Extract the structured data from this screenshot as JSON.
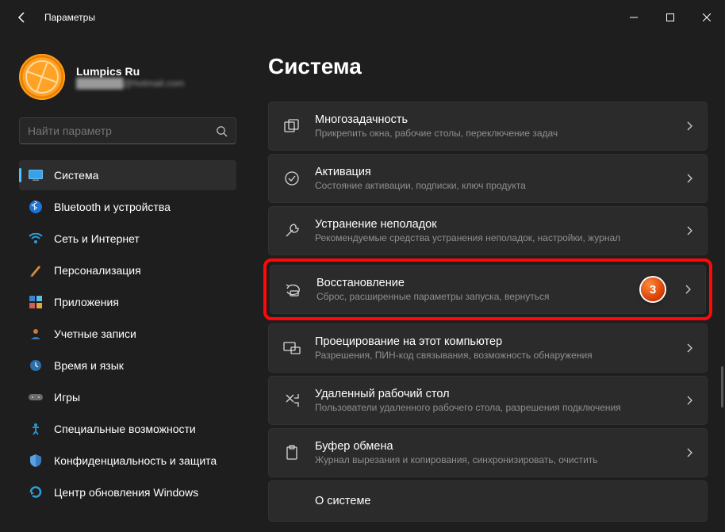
{
  "titlebar": {
    "title": "Параметры"
  },
  "user": {
    "name": "Lumpics Ru",
    "email": "███████@hotmail.com"
  },
  "search": {
    "placeholder": "Найти параметр"
  },
  "sidebar": {
    "items": [
      {
        "label": "Система"
      },
      {
        "label": "Bluetooth и устройства"
      },
      {
        "label": "Сеть и Интернет"
      },
      {
        "label": "Персонализация"
      },
      {
        "label": "Приложения"
      },
      {
        "label": "Учетные записи"
      },
      {
        "label": "Время и язык"
      },
      {
        "label": "Игры"
      },
      {
        "label": "Специальные возможности"
      },
      {
        "label": "Конфиденциальность и защита"
      },
      {
        "label": "Центр обновления Windows"
      }
    ]
  },
  "page": {
    "title": "Система"
  },
  "settings": [
    {
      "title": "Многозадачность",
      "desc": "Прикрепить окна, рабочие столы, переключение задач"
    },
    {
      "title": "Активация",
      "desc": "Состояние активации, подписки, ключ продукта"
    },
    {
      "title": "Устранение неполадок",
      "desc": "Рекомендуемые средства устранения неполадок, настройки, журнал"
    },
    {
      "title": "Восстановление",
      "desc": "Сброс, расширенные параметры запуска, вернуться"
    },
    {
      "title": "Проецирование на этот компьютер",
      "desc": "Разрешения, ПИН-код связывания, возможность обнаружения"
    },
    {
      "title": "Удаленный рабочий стол",
      "desc": "Пользователи удаленного рабочего стола, разрешения подключения"
    },
    {
      "title": "Буфер обмена",
      "desc": "Журнал вырезания и копирования, синхронизировать, очистить"
    },
    {
      "title": "О системе",
      "desc": ""
    }
  ],
  "annotation": {
    "step": "3",
    "highlighted_index": 3
  },
  "colors": {
    "accent": "#4cc2ff",
    "highlight": "#ff0808"
  }
}
